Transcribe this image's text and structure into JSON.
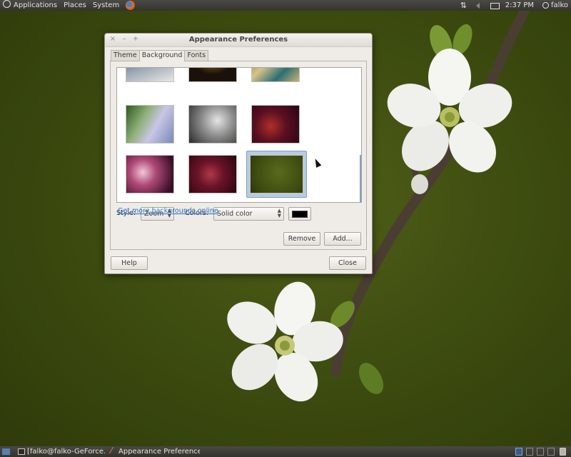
{
  "top_panel": {
    "menus": [
      "Applications",
      "Places",
      "System"
    ],
    "clock": "2:37 PM",
    "user": "falko",
    "icons": [
      "ubuntu-logo-icon",
      "firefox-icon",
      "network-arrows-icon",
      "speaker-icon",
      "mail-icon",
      "user-icon"
    ]
  },
  "window": {
    "title": "Appearance Preferences",
    "tabs": [
      "Theme",
      "Background",
      "Fonts"
    ],
    "active_tab": "Background",
    "style_label": "Style:",
    "style_value": "Zoom",
    "colors_label": "Colors:",
    "colors_value": "Solid color",
    "color_swatch": "#000000",
    "link_text": "Get more backgrounds online",
    "remove_label": "Remove",
    "add_label": "Add...",
    "help_label": "Help",
    "close_label": "Close"
  },
  "thumbnails": [
    {
      "name": "wallpaper-frost",
      "bg": "linear-gradient(160deg,#2e3f4e,#9aa8b4 55%,#e8e6e2)"
    },
    {
      "name": "wallpaper-dandelion-dark",
      "bg": "radial-gradient(circle at 50% 20%,#e3b34a 0,#8a5a18 25%,#1a120a 60%)"
    },
    {
      "name": "wallpaper-map",
      "bg": "linear-gradient(135deg,#7a6a3a,#d8c28a 40%,#2b6f73 70%,#c9b073)"
    },
    {
      "name": "wallpaper-purple-flower",
      "bg": "linear-gradient(120deg,#2e5a1e,#8fb07a 35%,#c9c6e6 60%,#7a88b8)"
    },
    {
      "name": "wallpaper-grey-branches",
      "bg": "radial-gradient(circle at 60% 40%,#e4e4e4,#8a8a8a 45%,#2a2a2a)"
    },
    {
      "name": "wallpaper-red-bokeh",
      "bg": "radial-gradient(circle at 40% 55%,#b03028,#5a0f22 45%,#2a0616)"
    },
    {
      "name": "wallpaper-pink-light",
      "bg": "radial-gradient(circle at 35% 45%,#f0c8d8,#b04a78 35%,#3a0e28 85%)"
    },
    {
      "name": "wallpaper-dark-red",
      "bg": "radial-gradient(circle at 45% 50%,#b0384a,#6a1428 40%,#2a0612)"
    },
    {
      "name": "wallpaper-blossom-green",
      "bg": "radial-gradient(circle at 55% 45%,#5a6a1c,#3c4a10 70%,#2c360a)"
    }
  ],
  "taskbar": {
    "terminal_task": "[falko@falko-GeForce...",
    "appearance_task": "Appearance Preferences"
  }
}
